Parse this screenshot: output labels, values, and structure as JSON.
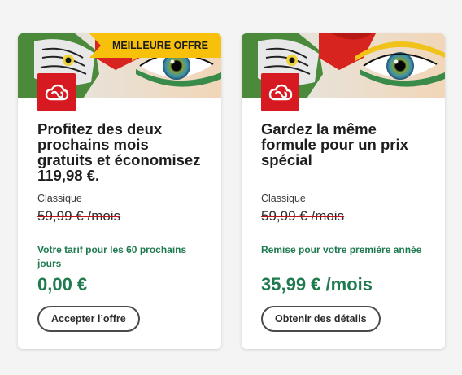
{
  "cards": [
    {
      "ribbon": "MEILLEURE OFFRE",
      "title": "Profitez des deux prochains mois gratuits et économisez 119,98 €.",
      "plan_label": "Classique",
      "old_price": "59,99 €",
      "old_price_period": "/mois",
      "promo": "Votre tarif pour les 60 prochains jours",
      "new_price": "0,00 €",
      "new_price_period": "",
      "button": "Accepter l’offre"
    },
    {
      "ribbon": "",
      "title": "Gardez la même formule pour un prix spécial",
      "plan_label": "Classique",
      "old_price": "59,99 €",
      "old_price_period": "/mois",
      "promo": "Remise pour votre première année",
      "new_price": "35,99 €",
      "new_price_period": "/mois",
      "button": "Obtenir des détails"
    }
  ],
  "icons": {
    "app_logo": "creative-cloud-icon",
    "hero": "parrot-eye-hero-image"
  },
  "colors": {
    "accent_red": "#d71a21",
    "ribbon_yellow": "#f7c00b",
    "promo_green": "#1f7a4f",
    "strike_red": "#c0141b"
  }
}
